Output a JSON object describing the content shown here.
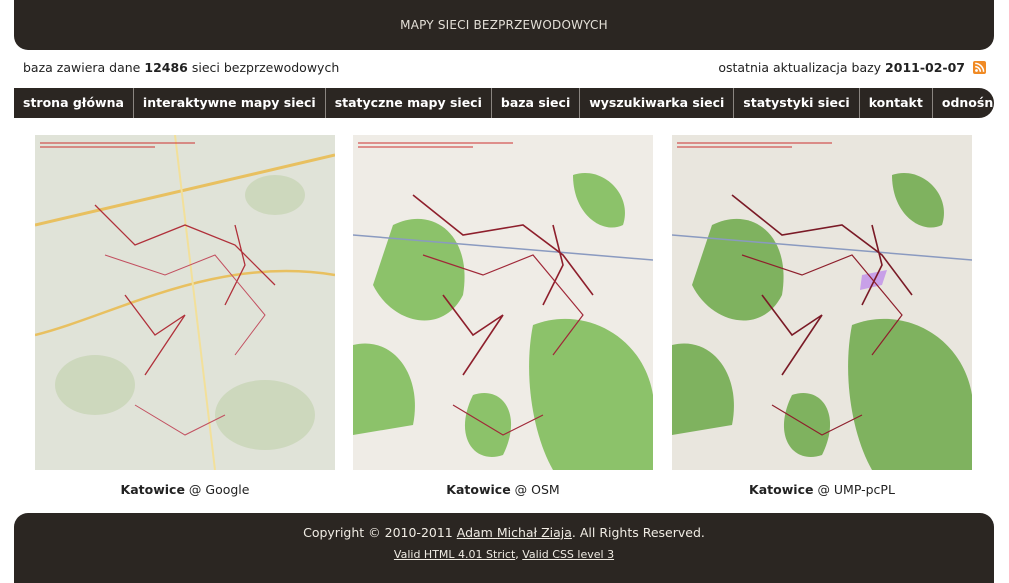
{
  "header": {
    "title": "MAPY SIECI BEZPRZEWODOWYCH"
  },
  "info": {
    "left_prefix": "baza zawiera dane",
    "network_count": "12486",
    "left_suffix": "sieci bezprzewodowych",
    "right_prefix": "ostatnia aktualizacja bazy",
    "last_update": "2011-02-07",
    "rss_icon": "rss-icon"
  },
  "nav": [
    {
      "label": "strona główna"
    },
    {
      "label": "interaktywne mapy sieci"
    },
    {
      "label": "statyczne mapy sieci"
    },
    {
      "label": "baza sieci"
    },
    {
      "label": "wyszukiwarka sieci"
    },
    {
      "label": "statystyki sieci"
    },
    {
      "label": "kontakt"
    },
    {
      "label": "odnośniki"
    }
  ],
  "maps": [
    {
      "city": "Katowice",
      "source": "@ Google",
      "style": "google"
    },
    {
      "city": "Katowice",
      "source": "@ OSM",
      "style": "osm"
    },
    {
      "city": "Katowice",
      "source": "@ UMP-pcPL",
      "style": "ump"
    }
  ],
  "footer": {
    "copyright_prefix": "Copyright © 2010-2011",
    "author": "Adam Michał Ziaja",
    "copyright_suffix": ". All Rights Reserved.",
    "valid_html": "Valid HTML 4.01 Strict",
    "separator": ",",
    "valid_css": "Valid CSS level 3"
  },
  "colors": {
    "dark": "#2b2622",
    "rss": "#f08a24",
    "osm_green": "#8cc26a",
    "google_bg": "#dfe3d7",
    "osm_bg": "#efece6",
    "network_red": "#b0303a"
  }
}
